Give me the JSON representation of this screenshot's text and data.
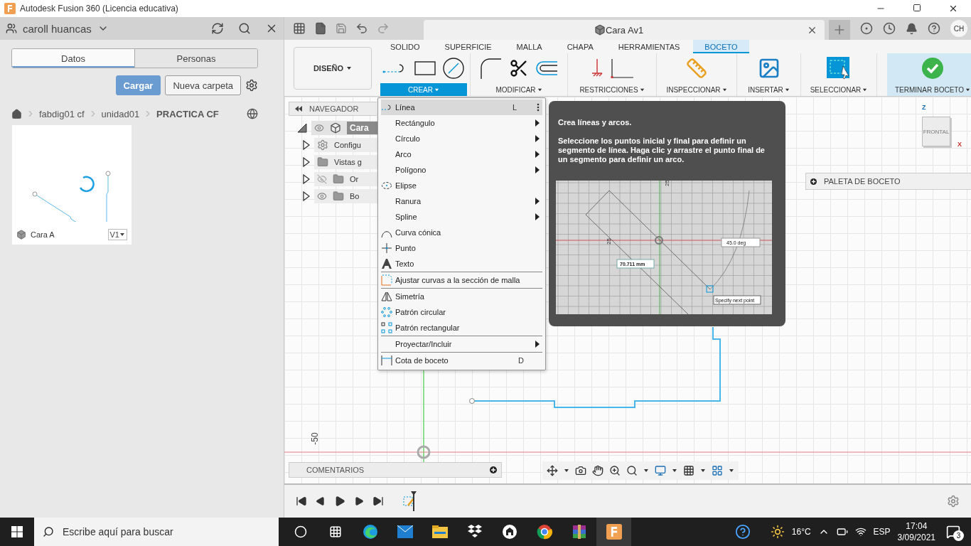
{
  "window": {
    "title": "Autodesk Fusion 360 (Licencia educativa)"
  },
  "data_panel": {
    "user": "caroll huancas",
    "tabs": [
      {
        "label": "Datos",
        "selected": true
      },
      {
        "label": "Personas",
        "selected": false
      }
    ],
    "actions": [
      {
        "label": "Cargar",
        "kind": "primary"
      },
      {
        "label": "Nueva carpeta",
        "kind": "secondary"
      }
    ],
    "breadcrumb": [
      "fabdig01 cf",
      "unidad01",
      "PRACTICA CF"
    ],
    "files": [
      {
        "name": "Cara A",
        "version": "V1"
      }
    ]
  },
  "document": {
    "title": "Cara Av1",
    "user_initials": "CH"
  },
  "workspace": "DISEÑO",
  "ribbon_tabs": [
    {
      "label": "SOLIDO",
      "selected": false
    },
    {
      "label": "SUPERFICIE",
      "selected": false
    },
    {
      "label": "MALLA",
      "selected": false
    },
    {
      "label": "CHAPA",
      "selected": false
    },
    {
      "label": "HERRAMIENTAS",
      "selected": false
    },
    {
      "label": "BOCETO",
      "selected": true
    }
  ],
  "ribbon_groups": [
    {
      "label": "CREAR",
      "open": true,
      "kind": "tools"
    },
    {
      "label": "MODIFICAR",
      "open": false,
      "kind": "tools"
    },
    {
      "label": "RESTRICCIONES",
      "open": false,
      "kind": "tools"
    },
    {
      "label": "INSPECCIONAR",
      "open": false,
      "kind": "tools"
    },
    {
      "label": "INSERTAR",
      "open": false,
      "kind": "tools"
    },
    {
      "label": "SELECCIONAR",
      "open": false,
      "kind": "tools"
    },
    {
      "label": "TERMINAR BOCETO",
      "open": false,
      "kind": "finish"
    }
  ],
  "navigator": {
    "title": "NAVEGADOR",
    "root": {
      "label": "Cara",
      "expanded": true,
      "visible": true
    },
    "items": [
      {
        "label": "Configu",
        "expanded": false,
        "kind": "settings"
      },
      {
        "label": "Vistas g",
        "expanded": false,
        "kind": "folder"
      },
      {
        "label": "Or",
        "expanded": false,
        "kind": "folder",
        "visible": false
      },
      {
        "label": "Bo",
        "expanded": false,
        "kind": "folder",
        "visible": true
      }
    ]
  },
  "create_menu": {
    "sections": [
      {
        "items": [
          {
            "label": "Línea",
            "shortcut": "L",
            "submenu": false,
            "selected": true
          },
          {
            "label": "Rectángulo",
            "submenu": true,
            "selected": false
          },
          {
            "label": "Círculo",
            "submenu": true,
            "selected": false
          },
          {
            "label": "Arco",
            "submenu": true,
            "selected": false
          },
          {
            "label": "Polígono",
            "submenu": true,
            "selected": false
          },
          {
            "label": "Elipse",
            "submenu": false,
            "selected": false
          },
          {
            "label": "Ranura",
            "submenu": true,
            "selected": false
          },
          {
            "label": "Spline",
            "submenu": true,
            "selected": false
          },
          {
            "label": "Curva cónica",
            "submenu": false,
            "selected": false
          },
          {
            "label": "Punto",
            "submenu": false,
            "selected": false
          },
          {
            "label": "Texto",
            "submenu": false,
            "selected": false
          }
        ]
      },
      {
        "items": [
          {
            "label": "Ajustar curvas a la sección de malla",
            "submenu": false,
            "selected": false
          }
        ]
      },
      {
        "items": [
          {
            "label": "Simetría",
            "submenu": false,
            "selected": false
          },
          {
            "label": "Patrón circular",
            "submenu": false,
            "selected": false
          },
          {
            "label": "Patrón rectangular",
            "submenu": false,
            "selected": false
          }
        ]
      },
      {
        "items": [
          {
            "label": "Proyectar/Incluir",
            "submenu": true,
            "selected": false
          }
        ]
      },
      {
        "items": [
          {
            "label": "Cota de boceto",
            "shortcut": "D",
            "submenu": false,
            "selected": false
          }
        ]
      }
    ]
  },
  "tooltip": {
    "title": "Crea líneas y arcos.",
    "body": "Seleccione los puntos inicial y final para definir un segmento de línea. Haga clic y arrastre el punto final de un segmento para definir un arco.",
    "illustration": {
      "axis_labels": [
        "25",
        "25"
      ],
      "length": "70.711 mm",
      "angle": "45.0 deg",
      "prompt": "Specify next point"
    }
  },
  "sketch_palette": {
    "title": "PALETA DE BOCETO"
  },
  "view_cube": {
    "face": "FRONTAL",
    "axis_up": "Z",
    "axis_right": "X"
  },
  "canvas": {
    "ruler_label": "-50"
  },
  "comments": {
    "title": "COMENTARIOS"
  },
  "taskbar": {
    "search_placeholder": "Escribe aquí para buscar",
    "temperature": "16°C",
    "language": "ESP",
    "time": "17:04",
    "date": "3/09/2021",
    "notifications": "3"
  }
}
